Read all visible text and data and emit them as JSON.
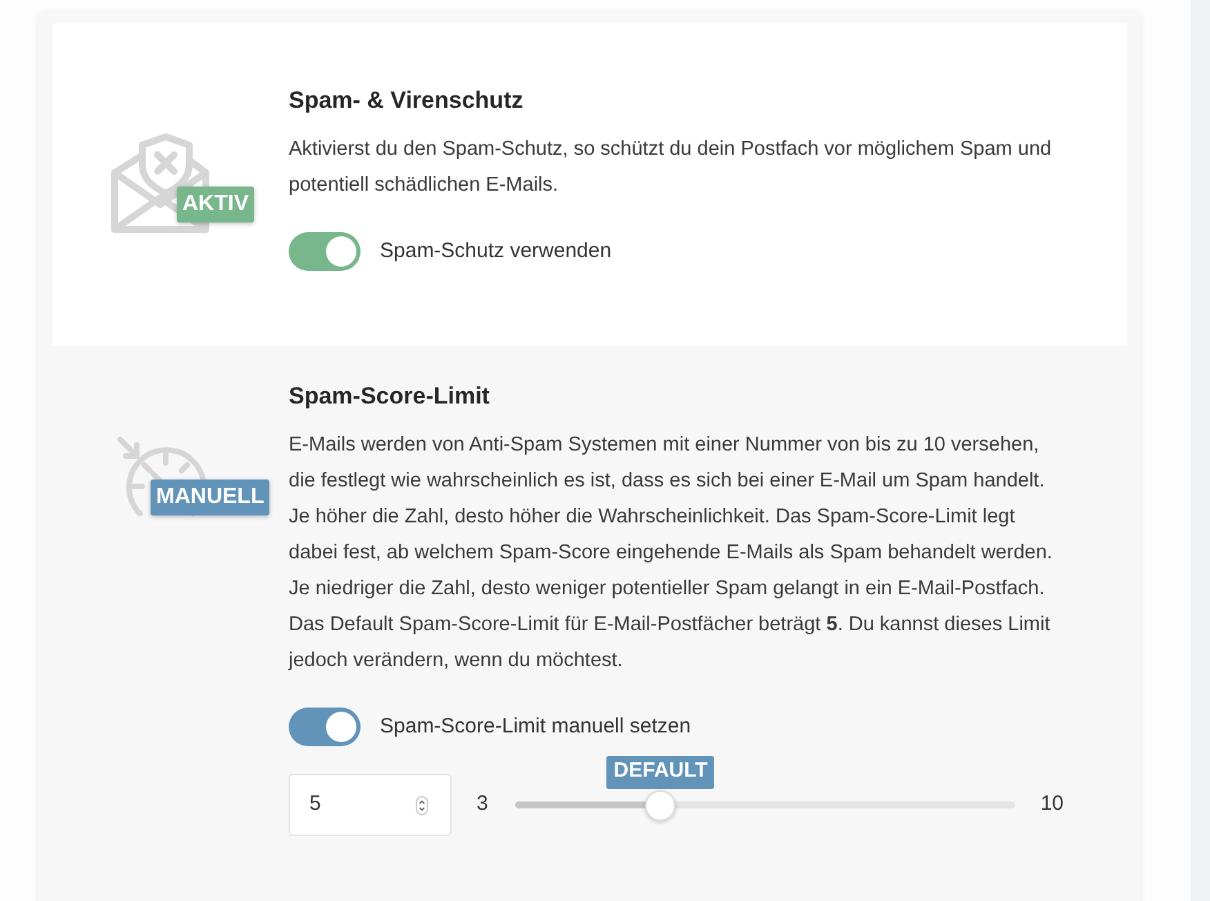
{
  "sections": [
    {
      "kind": "toggle",
      "highlighted": true,
      "title": "Spam- & Virenschutz",
      "description": "Aktivierst du den Spam-Schutz, so schützt du dein Postfach vor möglichem Spam und potentiell schädlichen E-Mails.",
      "badge": "AKTIV",
      "color": "#78b68c",
      "toggle": {
        "label": "Spam-Schutz verwenden",
        "on": true
      }
    },
    {
      "kind": "slider",
      "highlighted": false,
      "title": "Spam-Score-Limit",
      "description": "E-Mails werden von Anti-Spam Systemen mit einer Nummer von bis zu 10 versehen, die festlegt wie wahrscheinlich es ist, dass es sich bei einer E-Mail um Spam handelt. Je höher die Zahl, desto höher die Wahrscheinlichkeit. Das Spam-Score-Limit legt dabei fest, ab welchem Spam-Score eingehende E-Mails als Spam behandelt werden. Je niedriger die Zahl, desto weniger potentieller Spam gelangt in ein E-Mail-Postfach. Das Default Spam-Score-Limit für E-Mail-Postfächer beträgt **5**. Du kannst dieses Limit jedoch verändern, wenn du möchtest.",
      "badge": "MANUELL",
      "color": "#6293b8",
      "toggle": {
        "label": "Spam-Score-Limit manuell setzen",
        "on": true
      },
      "limit": {
        "value": "5",
        "min_label": "3",
        "max_label": "10",
        "level": 0.29,
        "marker": "DEFAULT"
      }
    }
  ]
}
